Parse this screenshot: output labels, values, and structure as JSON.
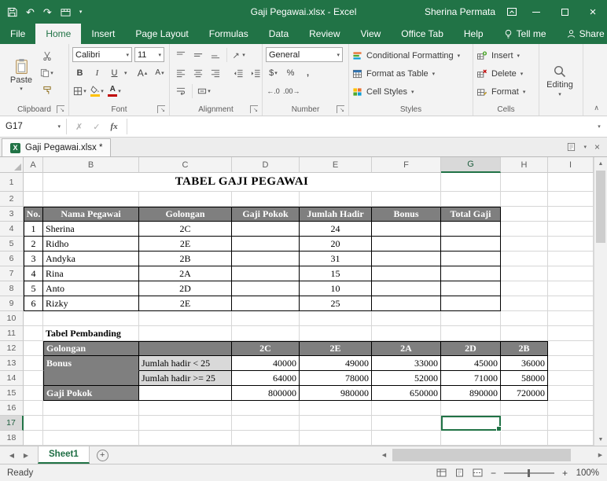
{
  "titlebar": {
    "title": "Gaji Pegawai.xlsx - Excel",
    "user": "Sherina Permata"
  },
  "ribbon": {
    "tabs": [
      "File",
      "Home",
      "Insert",
      "Page Layout",
      "Formulas",
      "Data",
      "Review",
      "View",
      "Office Tab",
      "Help"
    ],
    "tell_me_label": "Tell me",
    "share_label": "Share",
    "clipboard": {
      "paste": "Paste",
      "label": "Clipboard"
    },
    "font": {
      "name": "Calibri",
      "size": "11",
      "bold": "B",
      "italic": "I",
      "underline": "U",
      "label": "Font"
    },
    "alignment": {
      "label": "Alignment"
    },
    "number": {
      "format": "General",
      "label": "Number"
    },
    "styles": {
      "items": [
        "Conditional Formatting",
        "Format as Table",
        "Cell Styles"
      ],
      "label": "Styles"
    },
    "cells": {
      "items": [
        "Insert",
        "Delete",
        "Format"
      ],
      "label": "Cells"
    },
    "editing": {
      "label": "Editing"
    }
  },
  "formula_bar": {
    "name_box": "G17",
    "fx": "fx",
    "content": ""
  },
  "doc_tab_bar": {
    "active_tab": "Gaji Pegawai.xlsx *"
  },
  "sheet": {
    "col_headers": [
      "A",
      "B",
      "C",
      "D",
      "E",
      "F",
      "G",
      "H",
      "I"
    ],
    "row_headers": [
      "1",
      "2",
      "3",
      "4",
      "5",
      "6",
      "7",
      "8",
      "9",
      "10",
      "11",
      "12",
      "13",
      "14",
      "15",
      "16",
      "17",
      "18"
    ],
    "selected_cell": "G17",
    "title": "TABEL GAJI PEGAWAI",
    "main_table": {
      "headers": [
        "No.",
        "Nama Pegawai",
        "Golongan",
        "Gaji Pokok",
        "Jumlah Hadir",
        "Bonus",
        "Total Gaji"
      ],
      "rows": [
        [
          "1",
          "Sherina",
          "2C",
          "",
          "24",
          "",
          ""
        ],
        [
          "2",
          "Ridho",
          "2E",
          "",
          "20",
          "",
          ""
        ],
        [
          "3",
          "Andyka",
          "2B",
          "",
          "31",
          "",
          ""
        ],
        [
          "4",
          "Rina",
          "2A",
          "",
          "15",
          "",
          ""
        ],
        [
          "5",
          "Anto",
          "2D",
          "",
          "10",
          "",
          ""
        ],
        [
          "6",
          "Rizky",
          "2E",
          "",
          "25",
          "",
          ""
        ]
      ]
    },
    "pembanding": {
      "caption": "Tabel Pembanding",
      "row_label_golongan": "Golongan",
      "golongan_values": [
        "2C",
        "2E",
        "2A",
        "2D",
        "2B"
      ],
      "row_label_bonus": "Bonus",
      "bonus_rows": [
        {
          "label": "Jumlah hadir < 25",
          "values": [
            "40000",
            "49000",
            "33000",
            "45000",
            "36000"
          ]
        },
        {
          "label": "Jumlah hadir >= 25",
          "values": [
            "64000",
            "78000",
            "52000",
            "71000",
            "58000"
          ]
        }
      ],
      "row_label_gaji_pokok": "Gaji Pokok",
      "gaji_pokok_values": [
        "800000",
        "980000",
        "650000",
        "890000",
        "720000"
      ]
    }
  },
  "sheet_tab_bar": {
    "active_sheet": "Sheet1"
  },
  "status_bar": {
    "mode": "Ready",
    "zoom": "100%"
  },
  "icons": {
    "caret_down": "▾",
    "caret_up": "▴",
    "undo": "↶",
    "redo": "↷",
    "close": "×",
    "check": "✓",
    "cancel": "✗",
    "dollar": "$",
    "percent": "%",
    "comma": ",",
    "inc_decimal": "←.0",
    "dec_decimal": ".00→",
    "nav_left": "◀",
    "nav_right": "▶",
    "up": "▲",
    "down": "▼",
    "plus": "+",
    "minus": "−",
    "collapse": "∧",
    "launcher": "↘",
    "font_color_letter": "A",
    "excel_x": "X"
  },
  "colors": {
    "excel_green": "#217346",
    "table_header_gray": "#7F7F7F",
    "condition_gray": "#D9D9D9"
  }
}
